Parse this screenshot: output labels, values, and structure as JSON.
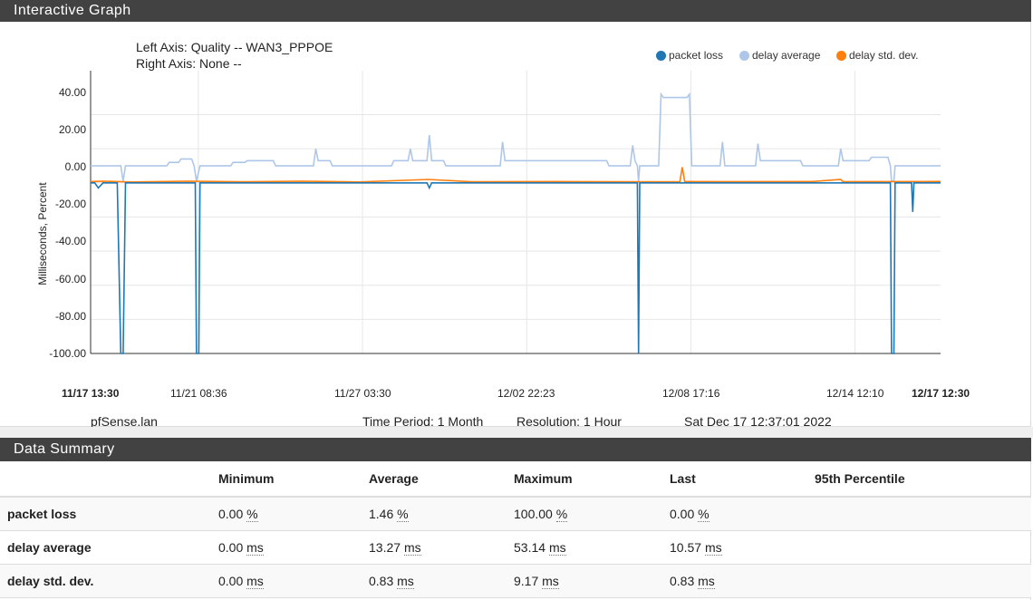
{
  "graph_panel": {
    "title": "Interactive Graph"
  },
  "summary_panel": {
    "title": "Data Summary"
  },
  "axes_info": {
    "left": "Left Axis: Quality -- WAN3_PPPOE",
    "right": "Right Axis: None --"
  },
  "footer": {
    "host": "pfSense.lan",
    "period": "Time Period: 1 Month",
    "resolution": "Resolution: 1 Hour",
    "timestamp": "Sat Dec 17 12:37:01 2022"
  },
  "colors": {
    "packet_loss": "#1f77b4",
    "delay_average": "#aec7e8",
    "delay_std_dev": "#ff7f0e",
    "header_bg": "#424242"
  },
  "chart_data": {
    "type": "line",
    "ylabel": "Milliseconds, Percent",
    "ylim": [
      -100,
      53
    ],
    "y_ticks": [
      "40.00",
      "20.00",
      "0.00",
      "-20.00",
      "-40.00",
      "-60.00",
      "-80.00",
      "-100.00"
    ],
    "x_ticks": [
      "11/17 13:30",
      "11/21 08:36",
      "11/27 03:30",
      "12/02 22:23",
      "12/08 17:16",
      "12/14 12:10",
      "12/17 12:30"
    ],
    "x_range": [
      "2022-11-17 13:30",
      "2022-12-17 12:30"
    ],
    "legend_position": "top-right",
    "grid": true,
    "series": [
      {
        "name": "packet loss",
        "points": [
          [
            "2022-11-17 13:30",
            0
          ],
          [
            "2022-11-17 17:00",
            0
          ],
          [
            "2022-11-17 20:00",
            -3
          ],
          [
            "2022-11-18 00:00",
            0
          ],
          [
            "2022-11-18 12:00",
            0
          ],
          [
            "2022-11-18 15:00",
            -100
          ],
          [
            "2022-11-18 17:00",
            -100
          ],
          [
            "2022-11-18 19:00",
            0
          ],
          [
            "2022-11-21 06:00",
            0
          ],
          [
            "2022-11-21 07:00",
            -100
          ],
          [
            "2022-11-21 09:00",
            -100
          ],
          [
            "2022-11-21 10:00",
            0
          ],
          [
            "2022-11-29 10:00",
            0
          ],
          [
            "2022-11-29 12:00",
            -3
          ],
          [
            "2022-11-29 14:00",
            0
          ],
          [
            "2022-12-06 20:00",
            0
          ],
          [
            "2022-12-06 21:00",
            -100
          ],
          [
            "2022-12-06 22:00",
            0
          ],
          [
            "2022-12-15 18:00",
            0
          ],
          [
            "2022-12-15 19:00",
            -100
          ],
          [
            "2022-12-15 21:00",
            -100
          ],
          [
            "2022-12-15 22:00",
            0
          ],
          [
            "2022-12-16 12:00",
            0
          ],
          [
            "2022-12-16 13:00",
            -17
          ],
          [
            "2022-12-16 14:00",
            0
          ],
          [
            "2022-12-17 12:30",
            0
          ]
        ]
      },
      {
        "name": "delay average",
        "points": [
          [
            "2022-11-17 13:30",
            10
          ],
          [
            "2022-11-18 15:00",
            10
          ],
          [
            "2022-11-18 17:00",
            1
          ],
          [
            "2022-11-18 19:00",
            10
          ],
          [
            "2022-11-20 06:00",
            10
          ],
          [
            "2022-11-20 08:00",
            12
          ],
          [
            "2022-11-20 16:00",
            12
          ],
          [
            "2022-11-20 18:00",
            14
          ],
          [
            "2022-11-21 03:00",
            14
          ],
          [
            "2022-11-21 05:00",
            10
          ],
          [
            "2022-11-21 07:00",
            1
          ],
          [
            "2022-11-21 10:00",
            10
          ],
          [
            "2022-11-22 12:00",
            10
          ],
          [
            "2022-11-22 14:00",
            12
          ],
          [
            "2022-11-23 00:00",
            12
          ],
          [
            "2022-11-23 02:00",
            13
          ],
          [
            "2022-11-24 00:00",
            13
          ],
          [
            "2022-11-24 02:00",
            10
          ],
          [
            "2022-11-25 10:00",
            10
          ],
          [
            "2022-11-25 12:00",
            20
          ],
          [
            "2022-11-25 14:00",
            13
          ],
          [
            "2022-11-26 00:00",
            13
          ],
          [
            "2022-11-26 02:00",
            10
          ],
          [
            "2022-11-28 04:00",
            10
          ],
          [
            "2022-11-28 06:00",
            13
          ],
          [
            "2022-11-28 18:00",
            13
          ],
          [
            "2022-11-28 20:00",
            20
          ],
          [
            "2022-11-28 22:00",
            13
          ],
          [
            "2022-11-29 10:00",
            13
          ],
          [
            "2022-11-29 12:00",
            28
          ],
          [
            "2022-11-29 14:00",
            13
          ],
          [
            "2022-11-30 00:00",
            13
          ],
          [
            "2022-11-30 02:00",
            10
          ],
          [
            "2022-12-02 00:00",
            10
          ],
          [
            "2022-12-02 02:00",
            24
          ],
          [
            "2022-12-02 04:00",
            13
          ],
          [
            "2022-12-05 18:00",
            13
          ],
          [
            "2022-12-05 20:00",
            10
          ],
          [
            "2022-12-06 14:00",
            10
          ],
          [
            "2022-12-06 16:00",
            22
          ],
          [
            "2022-12-06 18:00",
            13
          ],
          [
            "2022-12-06 20:00",
            10
          ],
          [
            "2022-12-06 21:00",
            1
          ],
          [
            "2022-12-06 22:00",
            10
          ],
          [
            "2022-12-07 14:00",
            10
          ],
          [
            "2022-12-07 16:00",
            52
          ],
          [
            "2022-12-07 18:00",
            50
          ],
          [
            "2022-12-08 14:00",
            50
          ],
          [
            "2022-12-08 16:00",
            52
          ],
          [
            "2022-12-08 18:00",
            10
          ],
          [
            "2022-12-09 18:00",
            10
          ],
          [
            "2022-12-09 20:00",
            24
          ],
          [
            "2022-12-09 22:00",
            10
          ],
          [
            "2022-12-11 00:00",
            10
          ],
          [
            "2022-12-11 02:00",
            23
          ],
          [
            "2022-12-11 04:00",
            13
          ],
          [
            "2022-12-12 14:00",
            13
          ],
          [
            "2022-12-12 16:00",
            10
          ],
          [
            "2022-12-13 22:00",
            10
          ],
          [
            "2022-12-14 00:00",
            20
          ],
          [
            "2022-12-14 02:00",
            13
          ],
          [
            "2022-12-15 00:00",
            13
          ],
          [
            "2022-12-15 02:00",
            15
          ],
          [
            "2022-12-15 16:00",
            15
          ],
          [
            "2022-12-15 18:00",
            10
          ],
          [
            "2022-12-15 19:00",
            1
          ],
          [
            "2022-12-15 21:00",
            1
          ],
          [
            "2022-12-15 22:00",
            10
          ],
          [
            "2022-12-17 12:30",
            10
          ]
        ]
      },
      {
        "name": "delay std. dev.",
        "points": [
          [
            "2022-11-17 13:30",
            0.8
          ],
          [
            "2022-11-18 00:00",
            1
          ],
          [
            "2022-11-19 00:00",
            0.5
          ],
          [
            "2022-11-21 00:00",
            1
          ],
          [
            "2022-11-23 00:00",
            0.6
          ],
          [
            "2022-11-25 00:00",
            1
          ],
          [
            "2022-11-27 00:00",
            0.5
          ],
          [
            "2022-11-29 11:00",
            2
          ],
          [
            "2022-12-01 00:00",
            0.6
          ],
          [
            "2022-12-04 00:00",
            0.8
          ],
          [
            "2022-12-07 00:00",
            0.6
          ],
          [
            "2022-12-08 08:00",
            0.6
          ],
          [
            "2022-12-08 10:00",
            9.17
          ],
          [
            "2022-12-08 12:00",
            0.8
          ],
          [
            "2022-12-10 00:00",
            0.7
          ],
          [
            "2022-12-13 00:00",
            0.8
          ],
          [
            "2022-12-14 00:00",
            2
          ],
          [
            "2022-12-14 02:00",
            0.7
          ],
          [
            "2022-12-17 12:30",
            0.83
          ]
        ]
      }
    ]
  },
  "summary": {
    "columns": [
      "Minimum",
      "Average",
      "Maximum",
      "Last",
      "95th Percentile"
    ],
    "rows": [
      {
        "name": "packet loss",
        "min": "0.00",
        "avg": "1.46",
        "max": "100.00",
        "last": "0.00",
        "unit": "%",
        "p95": ""
      },
      {
        "name": "delay average",
        "min": "0.00",
        "avg": "13.27",
        "max": "53.14",
        "last": "10.57",
        "unit": "ms",
        "p95": ""
      },
      {
        "name": "delay std. dev.",
        "min": "0.00",
        "avg": "0.83",
        "max": "9.17",
        "last": "0.83",
        "unit": "ms",
        "p95": ""
      }
    ]
  }
}
